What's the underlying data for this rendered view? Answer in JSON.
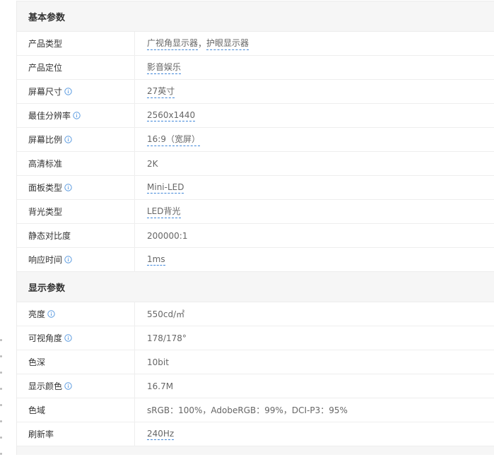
{
  "sections": [
    {
      "title": "基本参数",
      "rows": [
        {
          "label": "产品类型",
          "info": false,
          "values": [
            {
              "text": "广视角显示器",
              "link": true
            },
            {
              "text": "，",
              "link": false
            },
            {
              "text": "护眼显示器",
              "link": true
            }
          ]
        },
        {
          "label": "产品定位",
          "info": false,
          "values": [
            {
              "text": "影音娱乐",
              "link": true
            }
          ]
        },
        {
          "label": "屏幕尺寸",
          "info": true,
          "values": [
            {
              "text": "27英寸",
              "link": true
            }
          ]
        },
        {
          "label": "最佳分辨率",
          "info": true,
          "values": [
            {
              "text": "2560x1440",
              "link": true
            }
          ]
        },
        {
          "label": "屏幕比例",
          "info": true,
          "values": [
            {
              "text": "16:9（宽屏）",
              "link": true
            }
          ]
        },
        {
          "label": "高清标准",
          "info": false,
          "values": [
            {
              "text": "2K",
              "link": false
            }
          ]
        },
        {
          "label": "面板类型",
          "info": true,
          "values": [
            {
              "text": "Mini-LED",
              "link": true
            }
          ]
        },
        {
          "label": "背光类型",
          "info": false,
          "values": [
            {
              "text": "LED背光",
              "link": true
            }
          ]
        },
        {
          "label": "静态对比度",
          "info": false,
          "values": [
            {
              "text": "200000:1",
              "link": false
            }
          ]
        },
        {
          "label": "响应时间",
          "info": true,
          "values": [
            {
              "text": "1ms",
              "link": true
            }
          ]
        }
      ]
    },
    {
      "title": "显示参数",
      "rows": [
        {
          "label": "亮度",
          "info": true,
          "values": [
            {
              "text": "550cd/㎡",
              "link": false
            }
          ]
        },
        {
          "label": "可视角度",
          "info": true,
          "values": [
            {
              "text": "178/178°",
              "link": false
            }
          ]
        },
        {
          "label": "色深",
          "info": false,
          "values": [
            {
              "text": "10bit",
              "link": false
            }
          ]
        },
        {
          "label": "显示颜色",
          "info": true,
          "values": [
            {
              "text": "16.7M",
              "link": false
            }
          ]
        },
        {
          "label": "色域",
          "info": false,
          "values": [
            {
              "text": "sRGB：100%，AdobeRGB：99%，DCI-P3：95%",
              "link": false
            }
          ]
        },
        {
          "label": "刷新率",
          "info": false,
          "values": [
            {
              "text": "240Hz",
              "link": true
            }
          ]
        }
      ]
    }
  ],
  "colors": {
    "info_icon": "#5b9be0",
    "link_underline": "#3f86d8",
    "header_bg": "#f6f6f6",
    "border": "#ececec"
  },
  "icons": {
    "info": "info-icon"
  }
}
